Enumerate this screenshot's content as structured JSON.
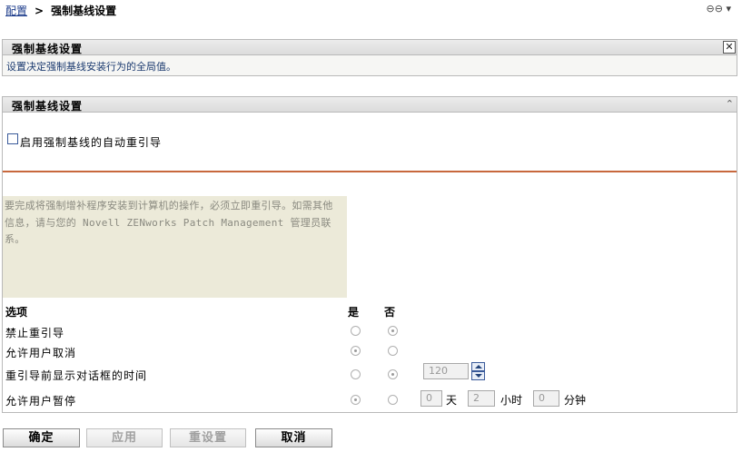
{
  "breadcrumb": {
    "parent": "配置",
    "separator": ">",
    "current": "强制基线设置"
  },
  "top_icons": {
    "link": "link-icon",
    "menu": "dropdown-icon"
  },
  "desc_panel": {
    "title": "强制基线设置",
    "description": "设置决定强制基线安装行为的全局值。",
    "close_icon": "close-icon"
  },
  "settings_panel": {
    "title": "强制基线设置",
    "collapse_icon": "collapse-up-icon",
    "auto_reboot_checkbox": {
      "label": "启用强制基线的自动重引导",
      "checked": false
    },
    "info_text": "要完成将强制增补程序安装到计算机的操作，必须立即重引导。如需其他信息，请与您的 Novell ZENworks Patch Management 管理员联系。",
    "options": {
      "header": "选项",
      "yes": "是",
      "no": "否",
      "rows": [
        {
          "label": "禁止重引导",
          "selected": "no"
        },
        {
          "label": "允许用户取消",
          "selected": "yes"
        },
        {
          "label": "重引导前显示对话框的时间",
          "selected": "no",
          "value": "120"
        },
        {
          "label": "允许用户暂停",
          "selected": "yes",
          "days": "0",
          "days_unit": "天",
          "hours": "2",
          "hours_unit": "小时",
          "minutes": "0",
          "minutes_unit": "分钟"
        }
      ]
    }
  },
  "buttons": {
    "ok": "确定",
    "apply": "应用",
    "reset": "重设置",
    "cancel": "取消"
  },
  "colors": {
    "accent_rule": "#c8683d",
    "link": "#1a3a8a",
    "info_bg": "#ecead9"
  }
}
